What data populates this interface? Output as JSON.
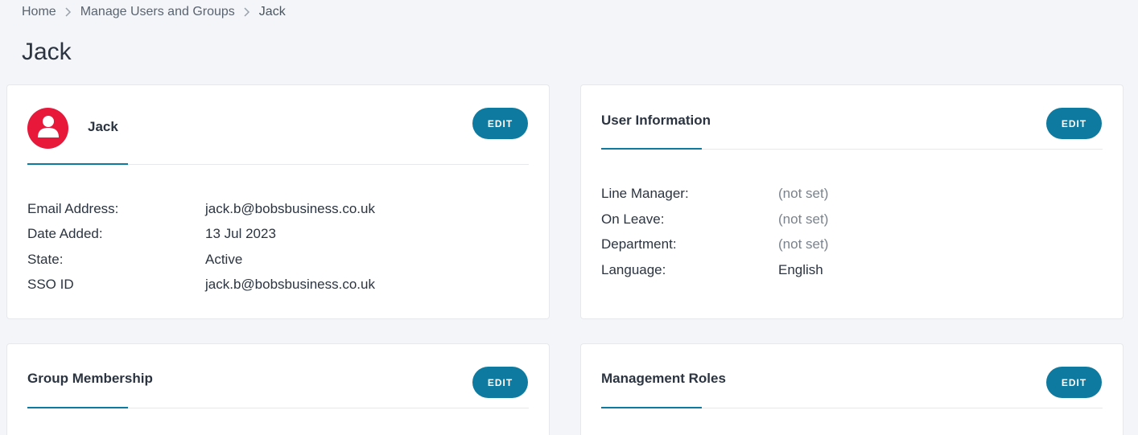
{
  "breadcrumb": {
    "items": [
      "Home",
      "Manage Users and Groups",
      "Jack"
    ]
  },
  "page": {
    "title": "Jack"
  },
  "profile_card": {
    "name": "Jack",
    "edit_label": "EDIT",
    "avatar_icon": "user-icon",
    "avatar_color": "#e8183a",
    "fields": [
      {
        "label": "Email Address:",
        "value": "jack.b@bobsbusiness.co.uk"
      },
      {
        "label": "Date Added:",
        "value": "13 Jul 2023"
      },
      {
        "label": "State:",
        "value": "Active"
      },
      {
        "label": "SSO ID",
        "value": "jack.b@bobsbusiness.co.uk"
      }
    ]
  },
  "user_info_card": {
    "heading": "User Information",
    "edit_label": "EDIT",
    "fields": [
      {
        "label": "Line Manager:",
        "value": "(not set)"
      },
      {
        "label": "On Leave:",
        "value": "(not set)"
      },
      {
        "label": "Department:",
        "value": "(not set)"
      },
      {
        "label": "Language:",
        "value": "English"
      }
    ]
  },
  "group_card": {
    "heading": "Group Membership",
    "edit_label": "EDIT"
  },
  "roles_card": {
    "heading": "Management Roles",
    "edit_label": "EDIT"
  },
  "colors": {
    "accent": "#0f7aa0",
    "avatar": "#e8183a",
    "background": "#f4f5f8",
    "muted_text": "#7a838d"
  }
}
